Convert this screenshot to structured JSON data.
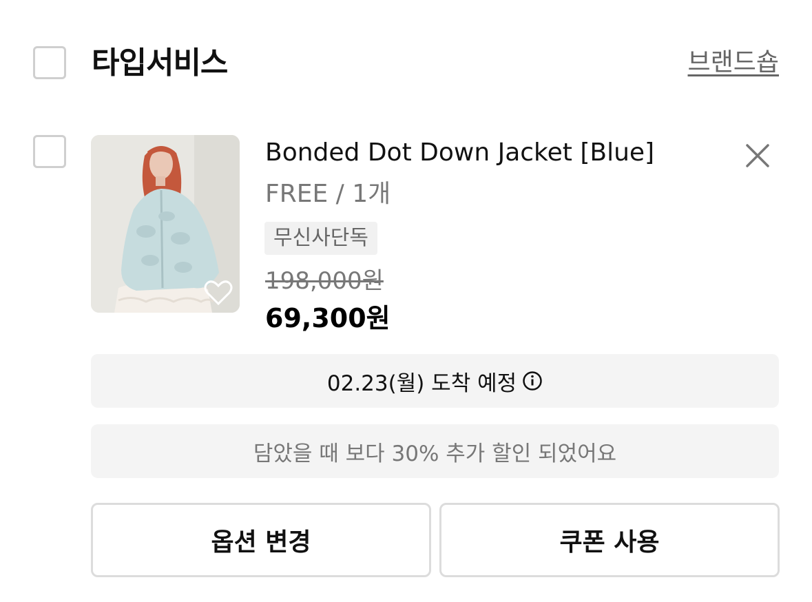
{
  "brand": {
    "name": "타입서비스",
    "shop_link": "브랜드숍"
  },
  "item": {
    "name": "Bonded Dot Down Jacket [Blue]",
    "option": "FREE / 1개",
    "badge": "무신사단독",
    "original_price": "198,000원",
    "sale_price": "69,300원",
    "image_alt": "jacket-photo"
  },
  "delivery": {
    "text": "02.23(월) 도착 예정"
  },
  "discount": {
    "text": "담았을 때 보다 30% 추가 할인 되었어요"
  },
  "buttons": {
    "change_option": "옵션 변경",
    "use_coupon": "쿠폰 사용"
  },
  "colors": {
    "panel_bg": "#f4f4f4",
    "muted_text": "#777777",
    "checkbox_border": "#cfcfcf"
  }
}
